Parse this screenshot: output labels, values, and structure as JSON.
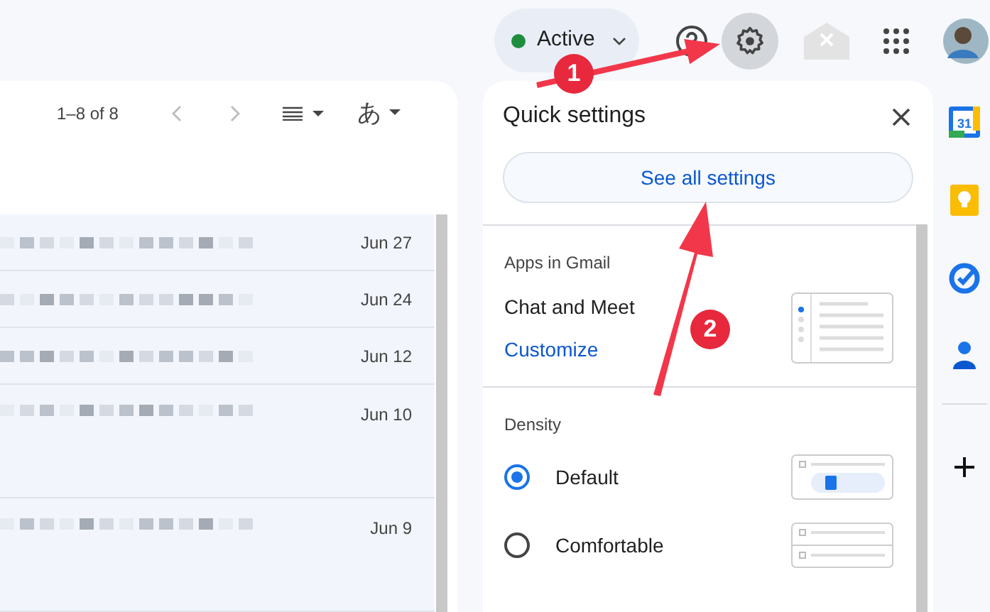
{
  "top_bar": {
    "status": {
      "label": "Active",
      "color": "#1e8e3e"
    },
    "settings_selected": true
  },
  "mail_list": {
    "pagination": "1–8 of 8",
    "input_tool": "あ",
    "rows": [
      {
        "date": "Jun 27",
        "kind": "single"
      },
      {
        "date": "Jun 24",
        "kind": "single"
      },
      {
        "date": "Jun 12",
        "kind": "single"
      },
      {
        "date": "Jun 10",
        "kind": "double"
      },
      {
        "date": "Jun 9",
        "kind": "double"
      }
    ]
  },
  "quick_settings": {
    "title": "Quick settings",
    "button": "See all settings",
    "apps_heading": "Apps in Gmail",
    "apps_label": "Chat and Meet",
    "customize": "Customize",
    "density_heading": "Density",
    "density": [
      {
        "label": "Default",
        "selected": true
      },
      {
        "label": "Comfortable",
        "selected": false
      }
    ]
  },
  "side_panel": {
    "calendar_day": "31"
  },
  "annotations": [
    {
      "label": "1"
    },
    {
      "label": "2"
    }
  ]
}
